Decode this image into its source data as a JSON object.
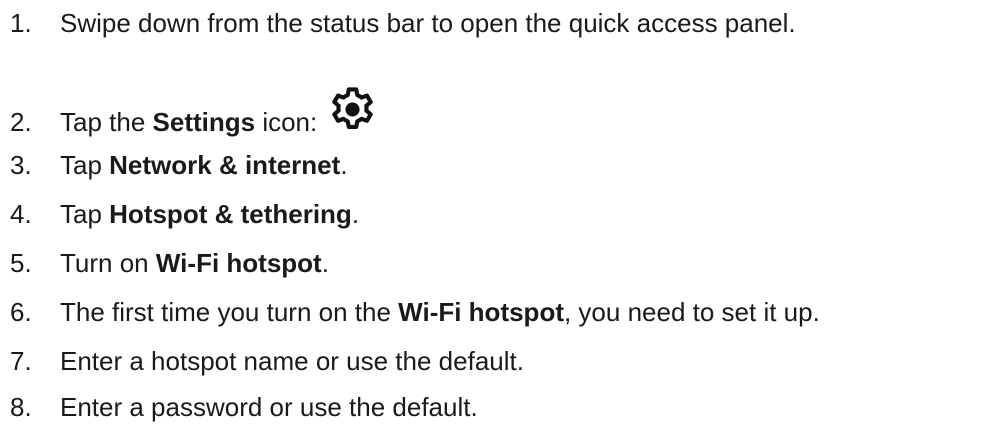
{
  "steps": [
    {
      "number": "1.",
      "parts": [
        "Swipe down from the status bar to open the quick access panel."
      ]
    },
    {
      "number": "2.",
      "pre": "Tap the ",
      "bold": "Settings",
      "post": " icon:",
      "icon": "gear-icon"
    },
    {
      "number": "3.",
      "pre": "Tap ",
      "bold": "Network & internet",
      "post": "."
    },
    {
      "number": "4.",
      "pre": "Tap ",
      "bold": "Hotspot & tethering",
      "post": "."
    },
    {
      "number": "5.",
      "pre": "Turn on ",
      "bold": "Wi-Fi hotspot",
      "post": "."
    },
    {
      "number": "6.",
      "pre": "The first time you turn on the ",
      "bold": "Wi-Fi hotspot",
      "post": ", you need to set it up."
    },
    {
      "number": "7.",
      "parts": [
        "Enter a hotspot name or use the default."
      ]
    },
    {
      "number": "8.",
      "parts": [
        "Enter a password or use the default."
      ]
    }
  ]
}
